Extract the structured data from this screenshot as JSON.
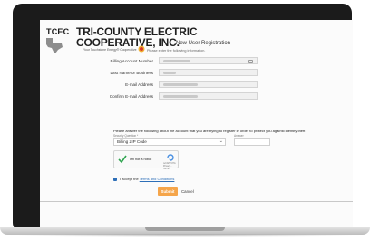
{
  "logo": {
    "abbr": "TCEC",
    "line1": "TRI-COUNTY ELECTRIC",
    "line2": "COOPERATIVE, INC.",
    "tagline": "Your Touchstone Energy® Cooperative"
  },
  "page": {
    "title": "New User Registration",
    "intro": "Please enter the following information."
  },
  "form": {
    "fields": [
      {
        "label": "Billing Account Number"
      },
      {
        "label": "Last Name or Business"
      },
      {
        "label": "E-mail Address"
      },
      {
        "label": "Confirm E-mail Address"
      }
    ],
    "verify_text": "Please answer the following about the account that you are trying to register in order to protect you against identity theft",
    "question_label": "Security Question *",
    "answer_label": "Answer",
    "question_value": "Billing ZIP Code",
    "captcha_text": "I'm not a robot",
    "captcha_sub": "reCAPTCHA  Privacy - Terms",
    "terms_prefix": "I accept the ",
    "terms_link": "Terms and Conditions",
    "submit_label": "Submit",
    "cancel_label": "Cancel"
  },
  "colors": {
    "accent": "#f5a54a",
    "link": "#2e6fb8",
    "check": "#2ea44f"
  }
}
